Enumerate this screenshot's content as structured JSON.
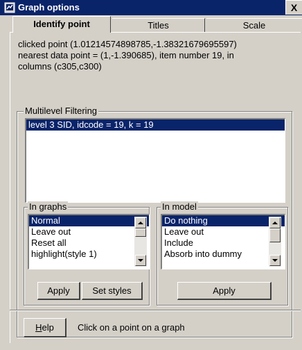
{
  "window": {
    "title": "Graph options",
    "close_label": "X"
  },
  "tabs": [
    {
      "label": "Identify point",
      "active": true
    },
    {
      "label": "Titles",
      "active": false
    },
    {
      "label": "Scale",
      "active": false
    }
  ],
  "info": {
    "line1": "clicked point (1.01214574898785,-1.38321679695597)",
    "line2": "nearest data point = (1,-1.390685), item number 19, in",
    "line3": "columns (c305,c300)"
  },
  "multilevel": {
    "legend": "Multilevel Filtering",
    "items": [
      {
        "label": "level 3  SID, idcode = 19,   k = 19",
        "selected": true
      }
    ]
  },
  "in_graphs": {
    "legend": "In graphs",
    "options": [
      "Normal",
      "Leave out",
      "Reset all",
      "highlight(style 1)"
    ],
    "selected": "Normal",
    "apply_label": "Apply",
    "set_styles_label": "Set styles"
  },
  "in_model": {
    "legend": "In model",
    "options": [
      "Do nothing",
      "Leave out",
      "Include",
      "Absorb into dummy"
    ],
    "selected": "Do nothing",
    "apply_label": "Apply"
  },
  "footer": {
    "help_label": "Help",
    "help_mnemonic": "H",
    "help_rest": "elp",
    "hint": "Click on a point on a graph"
  }
}
